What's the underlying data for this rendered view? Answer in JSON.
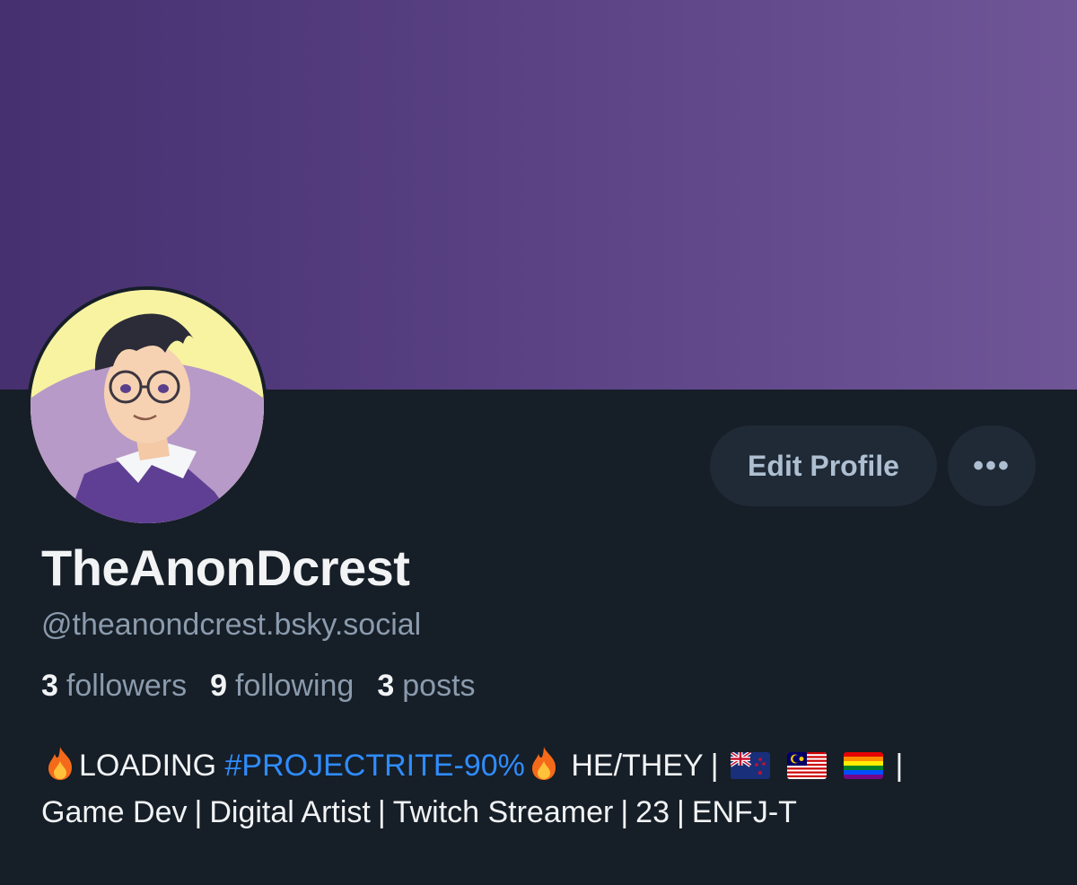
{
  "profile": {
    "display_name": "TheAnonDcrest",
    "handle": "@theanondcrest.bsky.social"
  },
  "actions": {
    "edit_label": "Edit Profile",
    "more_label": "•••"
  },
  "stats": {
    "followers_count": "3",
    "followers_label": "followers",
    "following_count": "9",
    "following_label": "following",
    "posts_count": "3",
    "posts_label": "posts"
  },
  "bio": {
    "loading": "LOADING",
    "hashtag": "#PROJECTRITE-90%",
    "pronouns": "HE/THEY",
    "separator": "|",
    "items": [
      "Game Dev",
      "Digital Artist",
      "Twitch Streamer",
      "23",
      "ENFJ-T"
    ],
    "icons": [
      "fire-icon",
      "fire-icon",
      "new-zealand-flag-icon",
      "malaysia-flag-icon",
      "rainbow-flag-icon"
    ]
  },
  "colors": {
    "background": "#161e27",
    "banner_start": "#46306f",
    "banner_end": "#6f5697",
    "hashtag": "#2f8cff",
    "button_bg": "#1f2a36",
    "muted_text": "#8b9bad"
  }
}
